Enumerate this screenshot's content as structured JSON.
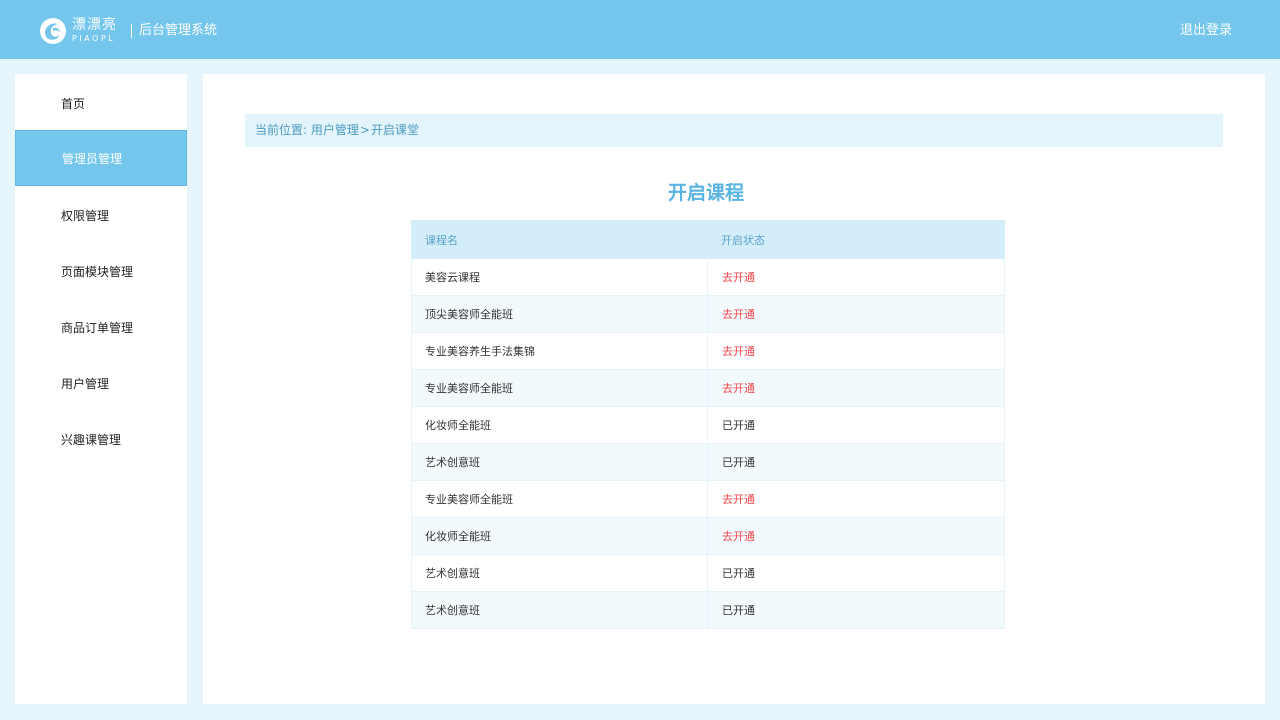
{
  "header": {
    "brand_cn": "漂漂亮",
    "brand_en": "PIAOPL",
    "system_title": "后台管理系统",
    "logout_label": "退出登录"
  },
  "sidebar": {
    "items": [
      {
        "label": "首页",
        "active": false
      },
      {
        "label": "管理员管理",
        "active": true
      },
      {
        "label": "权限管理",
        "active": false
      },
      {
        "label": "页面模块管理",
        "active": false
      },
      {
        "label": "商品订单管理",
        "active": false
      },
      {
        "label": "用户管理",
        "active": false
      },
      {
        "label": "兴趣课管理",
        "active": false
      }
    ]
  },
  "breadcrumb": {
    "prefix": "当前位置:",
    "level1": "用户管理",
    "separator": ">",
    "level2": "开启课堂"
  },
  "page_title": "开启课程",
  "table": {
    "columns": [
      "课程名",
      "开启状态"
    ],
    "rows": [
      {
        "course": "美容云课程",
        "status": "去开通"
      },
      {
        "course": "顶尖美容师全能班",
        "status": "去开通"
      },
      {
        "course": "专业美容养生手法集锦",
        "status": "去开通"
      },
      {
        "course": "专业美容师全能班",
        "status": "去开通"
      },
      {
        "course": "化妆师全能班",
        "status": "已开通"
      },
      {
        "course": "艺术创意班",
        "status": "已开通"
      },
      {
        "course": "专业美容师全能班",
        "status": "去开通"
      },
      {
        "course": "化妆师全能班",
        "status": "去开通"
      },
      {
        "course": "艺术创意班",
        "status": "已开通"
      },
      {
        "course": "艺术创意班",
        "status": "已开通"
      }
    ]
  },
  "colors": {
    "header_bg": "#74c6ec",
    "accent": "#58b4e0",
    "status_open": "#f0474b",
    "page_bg": "#e6f5fc"
  },
  "icons": {
    "logo": "swirl-logo-icon"
  }
}
